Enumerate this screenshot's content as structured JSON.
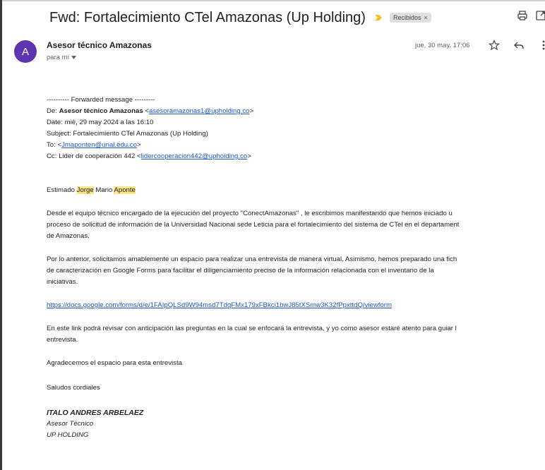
{
  "email": {
    "subject": "Fwd: Fortalecimiento CTel Amazonas (Up Holding)",
    "label_chip": "Recibidos",
    "label_chip_close": "×",
    "avatar_letter": "A",
    "avatar_color": "#5e35b1",
    "sender_name": "Asesor técnico Amazonas",
    "to_line": "para mí",
    "date": "jue, 30 may, 17:06"
  },
  "forwarded": {
    "separator": "---------- Forwarded message ---------",
    "from_label": "De:",
    "from_name": "Asesor técnico Amazonas",
    "from_email": "asesoramazonas1@upholding.co",
    "date_label": "Date:",
    "date_value": "mié, 29 may 2024 a las 16:10",
    "subject_label": "Subject:",
    "subject_value": "Fortalecimiento CTel Amazonas (Up Holding)",
    "to_label": "To:",
    "to_email": "Jmaponten@unal.edu.co",
    "cc_label": "Cc:",
    "cc_name": "Lider de cooperación 442",
    "cc_email": "lidercooperacion442@upholding.co"
  },
  "body": {
    "greeting_prefix": "Estimado",
    "greeting_first": "Jorge",
    "greeting_middle": "Mario",
    "greeting_last": "Aponte",
    "p1_lines": [
      "Desde el equipo técnico encargado de la ejecución del proyecto \"ConectAmazonas\" , le escribimos manifestando que hemos iniciado u",
      "proceso de solicitud de información de la Universidad Nacional sede Leticia para el fortalecimiento del sistema de CTel en el departament",
      "de Amazonas."
    ],
    "p2_lines": [
      "Por lo anterior, solicitamos amablemente un espacio para realizar una entrevista de manera virtual. Asimismo, hemos preparado una fich",
      "de caracterización en Google Forms para facilitar el diligenciamiento preciso de la información relacionada con el inventario de la",
      "iniciativas."
    ],
    "form_link": "https://docs.google.com/forms/d/e/1FAIpQLSd9W94msd7TdqFMx179xFBkci1bwJ85tXSmw3K32fPpxttdQ/viewform",
    "p3_lines": [
      "En este link podrá revisar con anticipación las preguntas en la cual se enfocará la entrevista, y yo como asesor estaré atento para guiar l",
      "entrevista."
    ],
    "p4": "Agradecemos el espacio para esta entrevista",
    "p5": "Saludos cordiales",
    "sig_name": "ITALO ANDRES ARBELAEZ",
    "sig_title": "Asesor Técnico",
    "sig_company": "UP HOLDING"
  }
}
